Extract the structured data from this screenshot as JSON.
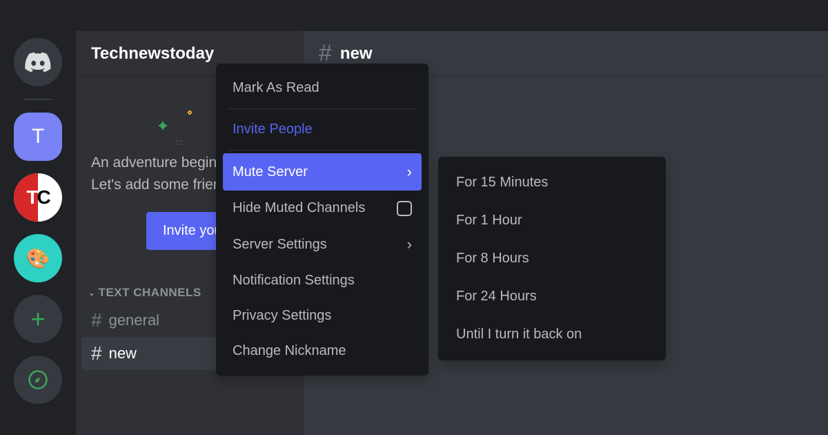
{
  "app": {
    "logo_text": "DISCORD"
  },
  "rail": {
    "servers": [
      {
        "kind": "home"
      },
      {
        "kind": "letter",
        "letter": "T"
      },
      {
        "kind": "tc"
      },
      {
        "kind": "art"
      },
      {
        "kind": "plus"
      },
      {
        "kind": "explore"
      }
    ]
  },
  "server": {
    "name": "Technewstoday",
    "welcome_line1": "An adventure begins.",
    "welcome_line2": "Let's add some friends!",
    "invite_label": "Invite your friends"
  },
  "channels": {
    "category_label": "TEXT CHANNELS",
    "items": [
      {
        "name": "general",
        "active": false
      },
      {
        "name": "new",
        "active": true
      }
    ]
  },
  "main": {
    "current_channel": "new"
  },
  "context_menu": {
    "items": [
      {
        "label": "Mark As Read",
        "type": "plain"
      },
      {
        "type": "sep"
      },
      {
        "label": "Invite People",
        "type": "invite"
      },
      {
        "type": "sep"
      },
      {
        "label": "Mute Server",
        "type": "submenu",
        "highlight": true
      },
      {
        "label": "Hide Muted Channels",
        "type": "checkbox"
      },
      {
        "label": "Server Settings",
        "type": "submenu"
      },
      {
        "label": "Notification Settings",
        "type": "plain"
      },
      {
        "label": "Privacy Settings",
        "type": "plain"
      },
      {
        "label": "Change Nickname",
        "type": "plain"
      }
    ]
  },
  "mute_submenu": {
    "items": [
      {
        "label": "For 15 Minutes"
      },
      {
        "label": "For 1 Hour"
      },
      {
        "label": "For 8 Hours"
      },
      {
        "label": "For 24 Hours"
      },
      {
        "label": "Until I turn it back on"
      }
    ]
  }
}
